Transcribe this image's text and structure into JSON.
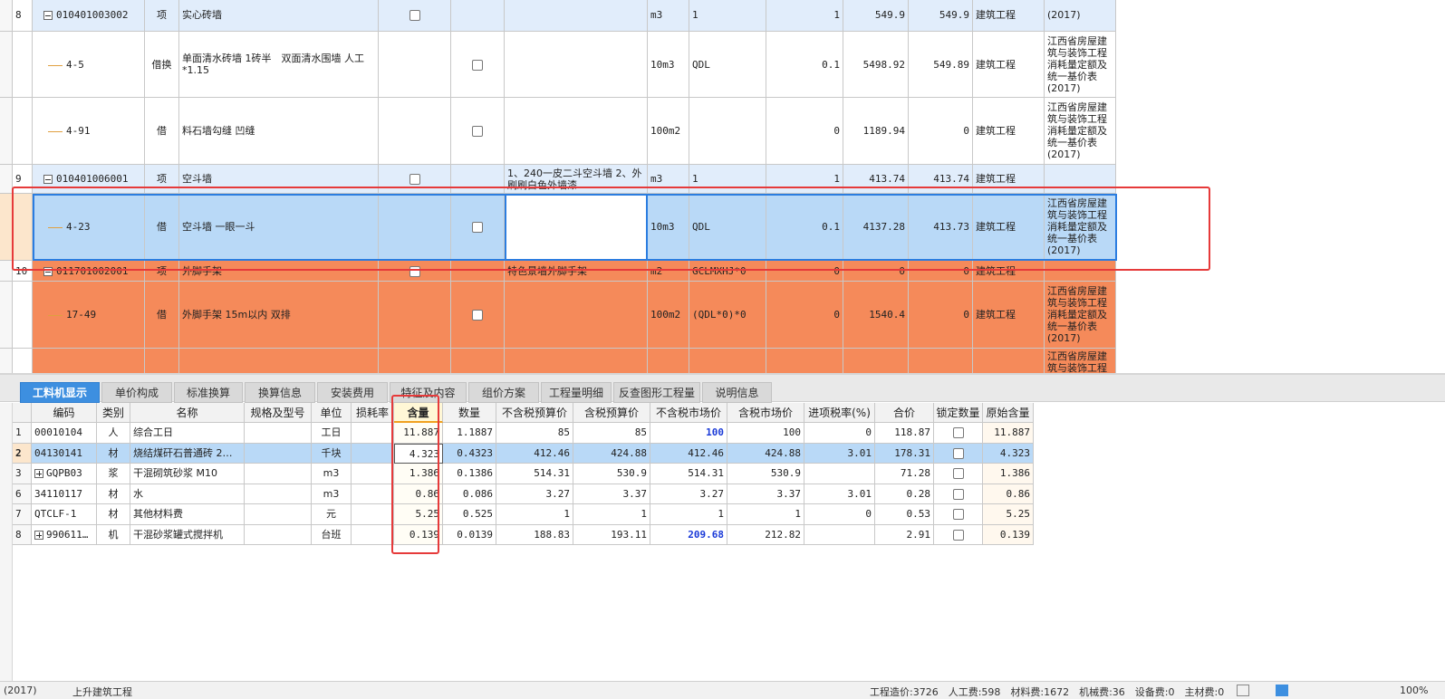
{
  "top_rows": [
    {
      "idx": "8",
      "code": "010401003002",
      "type": "项",
      "name": "实心砖墙",
      "feature": "",
      "unit": "m3",
      "expr": "1",
      "qty": "1",
      "price": "549.9",
      "total": "549.9",
      "major": "建筑工程",
      "source": "(2017)",
      "kind": "item",
      "top_cut": true
    },
    {
      "idx": "",
      "code": "4-5",
      "type": "借换",
      "name": "单面清水砖墙 1砖半　双面清水围墙 人工*1.15",
      "feature": "",
      "unit": "10m3",
      "expr": "QDL",
      "qty": "0.1",
      "price": "5498.92",
      "total": "549.89",
      "major": "建筑工程",
      "source": "江西省房屋建筑与装饰工程消耗量定额及统一基价表(2017)",
      "kind": "sub"
    },
    {
      "idx": "",
      "code": "4-91",
      "type": "借",
      "name": "料石墙勾缝 凹缝",
      "feature": "",
      "unit": "100m2",
      "expr": "",
      "qty": "0",
      "price": "1189.94",
      "total": "0",
      "major": "建筑工程",
      "source": "江西省房屋建筑与装饰工程消耗量定额及统一基价表(2017)",
      "kind": "sub"
    },
    {
      "idx": "9",
      "code": "010401006001",
      "type": "项",
      "name": "空斗墙",
      "feature": "1、240一皮二斗空斗墙 2、外刷刷白色外墙漆",
      "unit": "m3",
      "expr": "1",
      "qty": "1",
      "price": "413.74",
      "total": "413.74",
      "major": "建筑工程",
      "source": "",
      "kind": "item"
    },
    {
      "idx": "",
      "code": "4-23",
      "type": "借",
      "name": "空斗墙 一眼一斗",
      "feature": "",
      "unit": "10m3",
      "expr": "QDL",
      "qty": "0.1",
      "price": "4137.28",
      "total": "413.73",
      "major": "建筑工程",
      "source": "江西省房屋建筑与装饰工程消耗量定额及统一基价表(2017)",
      "kind": "selected"
    },
    {
      "idx": "10",
      "code": "011701002001",
      "type": "项",
      "name": "外脚手架",
      "feature": "特色景墙外脚手架",
      "unit": "m2",
      "expr": "GCLMXHJ*0",
      "qty": "0",
      "price": "0",
      "total": "0",
      "major": "建筑工程",
      "source": "",
      "kind": "orange-item"
    },
    {
      "idx": "",
      "code": "17-49",
      "type": "借",
      "name": "外脚手架 15m以内 双排",
      "feature": "",
      "unit": "100m2",
      "expr": "(QDL*0)*0",
      "qty": "0",
      "price": "1540.4",
      "total": "0",
      "major": "建筑工程",
      "source": "江西省房屋建筑与装饰工程消耗量定额及统一基价表(2017)",
      "kind": "orange-sub"
    },
    {
      "idx": "",
      "code": "",
      "type": "",
      "name": "",
      "feature": "",
      "unit": "",
      "expr": "",
      "qty": "",
      "price": "",
      "total": "",
      "major": "",
      "source": "江西省房屋建筑与装饰工程",
      "kind": "orange-cut"
    }
  ],
  "tabs": [
    "工料机显示",
    "单价构成",
    "标准换算",
    "换算信息",
    "安装费用",
    "特征及内容",
    "组价方案",
    "工程量明细",
    "反查图形工程量",
    "说明信息"
  ],
  "active_tab": 0,
  "bottom_headers": [
    "编码",
    "类别",
    "名称",
    "规格及型号",
    "单位",
    "损耗率",
    "含量",
    "数量",
    "不含税预算价",
    "含税预算价",
    "不含税市场价",
    "含税市场价",
    "进项税率(%)",
    "合价",
    "锁定数量",
    "原始含量"
  ],
  "bottom_rows": [
    {
      "no": "1",
      "code": "00010104",
      "cat": "人",
      "name": "综合工日",
      "spec": "",
      "unit": "工日",
      "loss": "",
      "content": "11.887",
      "qty": "1.1887",
      "pre": "85",
      "pre_tax": "85",
      "mkt": "100",
      "mkt_tax": "100",
      "tax": "0",
      "sum": "118.87",
      "orig": "11.887",
      "mkt_blue": true,
      "expand": false
    },
    {
      "no": "2",
      "code": "04130141",
      "cat": "材",
      "name": "烧结煤矸石普通砖 2…",
      "spec": "",
      "unit": "千块",
      "loss": "",
      "content": "4.323",
      "qty": "0.4323",
      "pre": "412.46",
      "pre_tax": "424.88",
      "mkt": "412.46",
      "mkt_tax": "424.88",
      "tax": "3.01",
      "sum": "178.31",
      "orig": "4.323",
      "mkt_blue": false,
      "expand": false,
      "selected": true
    },
    {
      "no": "3",
      "code": "GQPB03",
      "cat": "浆",
      "name": "干混砌筑砂浆 M10",
      "spec": "",
      "unit": "m3",
      "loss": "",
      "content": "1.386",
      "qty": "0.1386",
      "pre": "514.31",
      "pre_tax": "530.9",
      "mkt": "514.31",
      "mkt_tax": "530.9",
      "tax": "",
      "sum": "71.28",
      "orig": "1.386",
      "mkt_blue": false,
      "expand": true
    },
    {
      "no": "6",
      "code": "34110117",
      "cat": "材",
      "name": "水",
      "spec": "",
      "unit": "m3",
      "loss": "",
      "content": "0.86",
      "qty": "0.086",
      "pre": "3.27",
      "pre_tax": "3.37",
      "mkt": "3.27",
      "mkt_tax": "3.37",
      "tax": "3.01",
      "sum": "0.28",
      "orig": "0.86",
      "mkt_blue": false,
      "expand": false
    },
    {
      "no": "7",
      "code": "QTCLF-1",
      "cat": "材",
      "name": "其他材料费",
      "spec": "",
      "unit": "元",
      "loss": "",
      "content": "5.25",
      "qty": "0.525",
      "pre": "1",
      "pre_tax": "1",
      "mkt": "1",
      "mkt_tax": "1",
      "tax": "0",
      "sum": "0.53",
      "orig": "5.25",
      "mkt_blue": false,
      "expand": false
    },
    {
      "no": "8",
      "code": "990611…",
      "cat": "机",
      "name": "干混砂浆罐式搅拌机",
      "spec": "",
      "unit": "台班",
      "loss": "",
      "content": "0.139",
      "qty": "0.0139",
      "pre": "188.83",
      "pre_tax": "193.11",
      "mkt": "209.68",
      "mkt_tax": "212.82",
      "tax": "",
      "sum": "2.91",
      "orig": "0.139",
      "mkt_blue": true,
      "expand": true
    }
  ],
  "status": {
    "left": "(2017)",
    "middle": "上升建筑工程",
    "right": "工程造价:3726　人工费:598　材料费:1672　机械费:36　设备费:0　主材费:0",
    "zoom": "100%"
  },
  "colors": {
    "item_bg": "#e1edfb",
    "selected_bg": "#b9d9f7",
    "orange_bg": "#f58a5a",
    "highlight": "#e63a3a",
    "tab_active": "#3d8fe0"
  }
}
